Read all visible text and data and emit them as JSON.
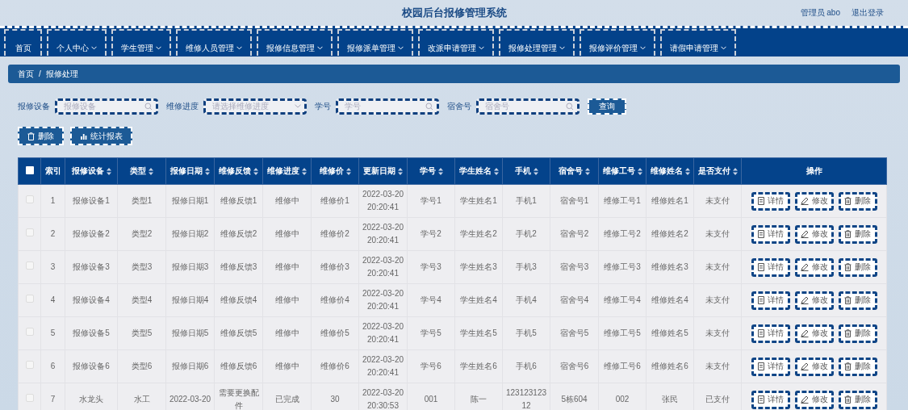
{
  "header": {
    "title": "校园后台报修管理系统",
    "user": "管理员 abo",
    "logout": "退出登录"
  },
  "nav": [
    {
      "label": "首页",
      "dropdown": false
    },
    {
      "label": "个人中心",
      "dropdown": true
    },
    {
      "label": "学生管理",
      "dropdown": true
    },
    {
      "label": "维修人员管理",
      "dropdown": true
    },
    {
      "label": "报修信息管理",
      "dropdown": true
    },
    {
      "label": "报修派单管理",
      "dropdown": true
    },
    {
      "label": "改派申请管理",
      "dropdown": true
    },
    {
      "label": "报修处理管理",
      "dropdown": true
    },
    {
      "label": "报修评价管理",
      "dropdown": true
    },
    {
      "label": "请假申请管理",
      "dropdown": true
    }
  ],
  "breadcrumb": {
    "items": [
      "首页",
      "报修处理"
    ],
    "separator": "/"
  },
  "search": {
    "fields": [
      {
        "label": "报修设备",
        "kind": "text",
        "placeholder": "报修设备"
      },
      {
        "label": "维修进度",
        "kind": "select",
        "placeholder": "请选择维修进度"
      },
      {
        "label": "学号",
        "kind": "text",
        "placeholder": "学号"
      },
      {
        "label": "宿舍号",
        "kind": "text",
        "placeholder": "宿舍号"
      }
    ],
    "button": "查询"
  },
  "toolbar": [
    {
      "label": "删除",
      "kind": "delete"
    },
    {
      "label": "统计报表",
      "kind": "chart"
    }
  ],
  "table": {
    "select_all": {
      "checked": false
    },
    "columns": [
      {
        "label": "索引",
        "sortable": false
      },
      {
        "label": "报修设备",
        "sortable": true
      },
      {
        "label": "类型",
        "sortable": true
      },
      {
        "label": "报修日期",
        "sortable": true
      },
      {
        "label": "维修反馈",
        "sortable": true
      },
      {
        "label": "维修进度",
        "sortable": true
      },
      {
        "label": "维修价",
        "sortable": true
      },
      {
        "label": "更新日期",
        "sortable": true
      },
      {
        "label": "学号",
        "sortable": true
      },
      {
        "label": "学生姓名",
        "sortable": true
      },
      {
        "label": "手机",
        "sortable": true
      },
      {
        "label": "宿舍号",
        "sortable": true
      },
      {
        "label": "维修工号",
        "sortable": true
      },
      {
        "label": "维修姓名",
        "sortable": true
      },
      {
        "label": "是否支付",
        "sortable": true
      },
      {
        "label": "操作",
        "sortable": false
      }
    ],
    "rows": [
      {
        "checked": false,
        "cells": [
          "1",
          "报修设备1",
          "类型1",
          "报修日期1",
          "维修反馈1",
          "维修中",
          "维修价1",
          "2022-03-20 20:20:41",
          "学号1",
          "学生姓名1",
          "手机1",
          "宿舍号1",
          "维修工号1",
          "维修姓名1",
          "未支付"
        ],
        "actions": [
          {
            "label": "详情",
            "kind": "detail"
          },
          {
            "label": "修改",
            "kind": "edit"
          },
          {
            "label": "删除",
            "kind": "delete"
          }
        ]
      },
      {
        "checked": false,
        "cells": [
          "2",
          "报修设备2",
          "类型2",
          "报修日期2",
          "维修反馈2",
          "维修中",
          "维修价2",
          "2022-03-20 20:20:41",
          "学号2",
          "学生姓名2",
          "手机2",
          "宿舍号2",
          "维修工号2",
          "维修姓名2",
          "未支付"
        ],
        "actions": [
          {
            "label": "详情",
            "kind": "detail"
          },
          {
            "label": "修改",
            "kind": "edit"
          },
          {
            "label": "删除",
            "kind": "delete"
          }
        ]
      },
      {
        "checked": false,
        "cells": [
          "3",
          "报修设备3",
          "类型3",
          "报修日期3",
          "维修反馈3",
          "维修中",
          "维修价3",
          "2022-03-20 20:20:41",
          "学号3",
          "学生姓名3",
          "手机3",
          "宿舍号3",
          "维修工号3",
          "维修姓名3",
          "未支付"
        ],
        "actions": [
          {
            "label": "详情",
            "kind": "detail"
          },
          {
            "label": "修改",
            "kind": "edit"
          },
          {
            "label": "删除",
            "kind": "delete"
          }
        ]
      },
      {
        "checked": false,
        "cells": [
          "4",
          "报修设备4",
          "类型4",
          "报修日期4",
          "维修反馈4",
          "维修中",
          "维修价4",
          "2022-03-20 20:20:41",
          "学号4",
          "学生姓名4",
          "手机4",
          "宿舍号4",
          "维修工号4",
          "维修姓名4",
          "未支付"
        ],
        "actions": [
          {
            "label": "详情",
            "kind": "detail"
          },
          {
            "label": "修改",
            "kind": "edit"
          },
          {
            "label": "删除",
            "kind": "delete"
          }
        ]
      },
      {
        "checked": false,
        "cells": [
          "5",
          "报修设备5",
          "类型5",
          "报修日期5",
          "维修反馈5",
          "维修中",
          "维修价5",
          "2022-03-20 20:20:41",
          "学号5",
          "学生姓名5",
          "手机5",
          "宿舍号5",
          "维修工号5",
          "维修姓名5",
          "未支付"
        ],
        "actions": [
          {
            "label": "详情",
            "kind": "detail"
          },
          {
            "label": "修改",
            "kind": "edit"
          },
          {
            "label": "删除",
            "kind": "delete"
          }
        ]
      },
      {
        "checked": false,
        "cells": [
          "6",
          "报修设备6",
          "类型6",
          "报修日期6",
          "维修反馈6",
          "维修中",
          "维修价6",
          "2022-03-20 20:20:41",
          "学号6",
          "学生姓名6",
          "手机6",
          "宿舍号6",
          "维修工号6",
          "维修姓名6",
          "未支付"
        ],
        "actions": [
          {
            "label": "详情",
            "kind": "detail"
          },
          {
            "label": "修改",
            "kind": "edit"
          },
          {
            "label": "删除",
            "kind": "delete"
          }
        ]
      },
      {
        "checked": false,
        "cells": [
          "7",
          "水龙头",
          "水工",
          "2022-03-20",
          "需要更换配件",
          "已完成",
          "30",
          "2022-03-20 20:30:53",
          "001",
          "陈一",
          "12312312312",
          "5栋604",
          "002",
          "张民",
          "已支付"
        ],
        "actions": [
          {
            "label": "详情",
            "kind": "detail"
          },
          {
            "label": "修改",
            "kind": "edit"
          },
          {
            "label": "删除",
            "kind": "delete"
          }
        ]
      }
    ]
  }
}
